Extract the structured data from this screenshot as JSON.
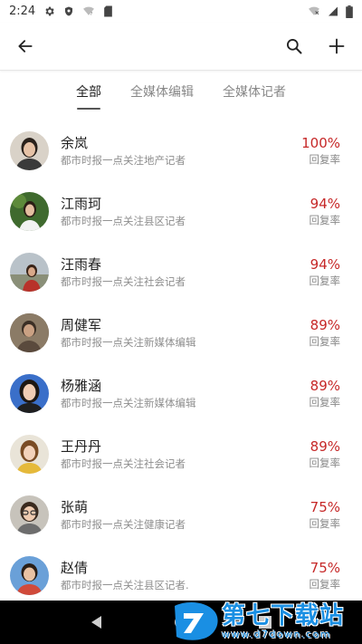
{
  "status_bar": {
    "time": "2:24"
  },
  "tabs": [
    {
      "label": "全部",
      "active": true
    },
    {
      "label": "全媒体编辑",
      "active": false
    },
    {
      "label": "全媒体记者",
      "active": false
    }
  ],
  "rate_label": "回复率",
  "accent_color": "#c62828",
  "people": [
    {
      "name": "余岚",
      "desc": "都市时报一点关注地产记者",
      "rate": "100%"
    },
    {
      "name": "江雨珂",
      "desc": "都市时报一点关注县区记者",
      "rate": "94%"
    },
    {
      "name": "汪雨春",
      "desc": "都市时报一点关注社会记者",
      "rate": "94%"
    },
    {
      "name": "周健军",
      "desc": "都市时报一点关注新媒体编辑",
      "rate": "89%"
    },
    {
      "name": "杨雅涵",
      "desc": "都市时报一点关注新媒体编辑",
      "rate": "89%"
    },
    {
      "name": "王丹丹",
      "desc": "都市时报一点关注社会记者",
      "rate": "89%"
    },
    {
      "name": "张萌",
      "desc": "都市时报一点关注健康记者",
      "rate": "75%"
    },
    {
      "name": "赵倩",
      "desc": "都市时报一点关注县区记者.",
      "rate": "75%"
    }
  ],
  "watermark": {
    "title": "第七下载站",
    "url": "www.d7down.com"
  }
}
